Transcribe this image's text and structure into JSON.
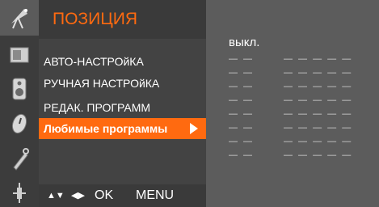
{
  "menu": {
    "title": "ПОЗИЦИЯ",
    "items": [
      {
        "label": "АВТО-НАСТРОйКА"
      },
      {
        "label": "РУЧНАЯ НАСТРОйКА"
      },
      {
        "label": "РЕДАК. ПРОГРАММ"
      },
      {
        "label": "Любимые программы"
      }
    ],
    "selected_index": 3
  },
  "nav": {
    "updown": "▲▼",
    "leftright": "◀▶",
    "ok": "OK",
    "menu": "MENU"
  },
  "panel": {
    "first_value": "выкл.",
    "rows": [
      {
        "short": "— —",
        "long": "— — — — —"
      },
      {
        "short": "— —",
        "long": "— — — — —"
      },
      {
        "short": "— —",
        "long": "— — — — —"
      },
      {
        "short": "— —",
        "long": "— — — — —"
      },
      {
        "short": "— —",
        "long": "— — — — —"
      },
      {
        "short": "— —",
        "long": "— — — — —"
      },
      {
        "short": "— —",
        "long": "— — — — —"
      },
      {
        "short": "— —",
        "long": "— — — — —"
      }
    ]
  },
  "icons": [
    "satellite-dish-icon",
    "screen-icon",
    "speaker-icon",
    "clock-icon",
    "lock-tag-icon",
    "plug-icon"
  ],
  "colors": {
    "accent": "#ff6a10",
    "left_bg": "#3c3c3c",
    "menu_bg": "#434343",
    "panel_bg": "#5c5c5c"
  }
}
